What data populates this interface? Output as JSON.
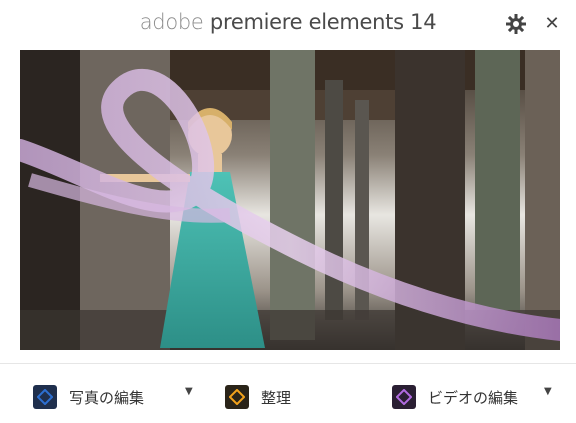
{
  "window": {
    "title_brand": "adobe",
    "title_product": "premiere elements 14",
    "icons": {
      "settings": "gear-icon",
      "close": "close-icon",
      "close_glyph": "✕"
    }
  },
  "actions": [
    {
      "label": "写真の編集",
      "icon": "photo-editor-icon",
      "icon_color": "#2d6fd1",
      "has_dropdown": true
    },
    {
      "label": "整理",
      "icon": "organizer-icon",
      "icon_color": "#f2a21c",
      "has_dropdown": false
    },
    {
      "label": "ビデオの編集",
      "icon": "video-editor-icon",
      "icon_color": "#b06be0",
      "has_dropdown": true
    }
  ],
  "dropdown_glyph": "▼"
}
